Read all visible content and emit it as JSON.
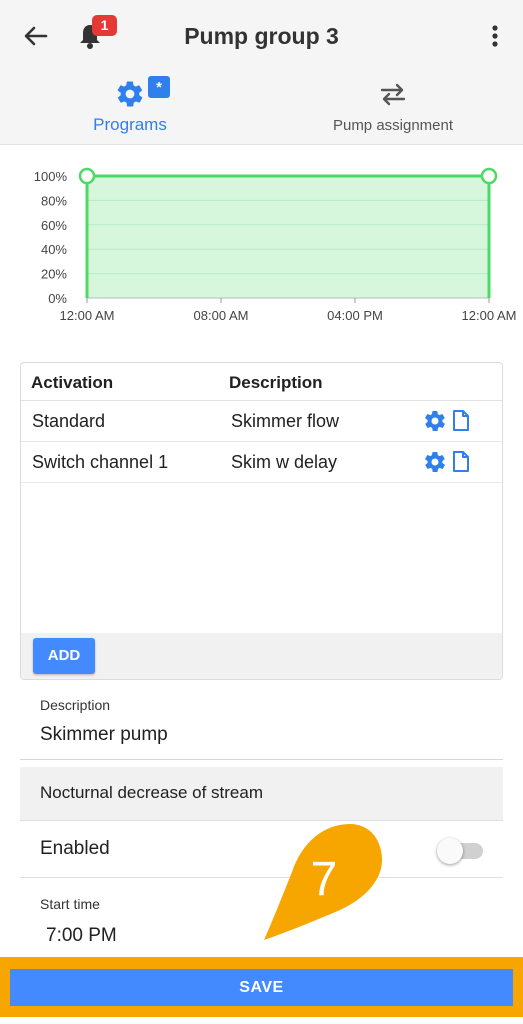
{
  "header": {
    "title": "Pump group 3",
    "notification_count": "1",
    "icons": {
      "back": "arrow-left-icon",
      "bell": "bell-icon",
      "more": "more-vert-icon"
    }
  },
  "tabs": [
    {
      "label": "Programs",
      "icon": "gear-icon",
      "badge": "*",
      "active": true
    },
    {
      "label": "Pump assignment",
      "icon": "swap-arrows-icon",
      "active": false
    }
  ],
  "chart_data": {
    "type": "area",
    "x_tick_labels": [
      "12:00 AM",
      "08:00 AM",
      "04:00 PM",
      "12:00 AM"
    ],
    "y_tick_labels": [
      "100%",
      "80%",
      "60%",
      "40%",
      "20%",
      "0%"
    ],
    "ylim": [
      0,
      100
    ],
    "x_hours": [
      0,
      24
    ],
    "points": [
      {
        "x": 0,
        "y": 100
      },
      {
        "x": 24,
        "y": 100
      }
    ],
    "line_color": "#4cd964",
    "fill_color": "#d6f7dc",
    "grid": true
  },
  "table": {
    "headers": [
      "Activation",
      "Description"
    ],
    "rows": [
      {
        "activation": "Standard",
        "description": "Skimmer flow"
      },
      {
        "activation": "Switch channel 1",
        "description": "Skim w delay"
      }
    ],
    "add_label": "ADD"
  },
  "form": {
    "description_label": "Description",
    "description_value": "Skimmer pump",
    "nocturnal_label": "Nocturnal decrease of stream",
    "enabled_label": "Enabled",
    "enabled": false,
    "start_time_label": "Start time",
    "start_time_value": "7:00 PM"
  },
  "step_marker": {
    "number": "7",
    "color": "#f7a600"
  },
  "save_label": "SAVE",
  "colors": {
    "accent": "#2f80ed",
    "button": "#448aff",
    "highlight": "#f7a600"
  }
}
